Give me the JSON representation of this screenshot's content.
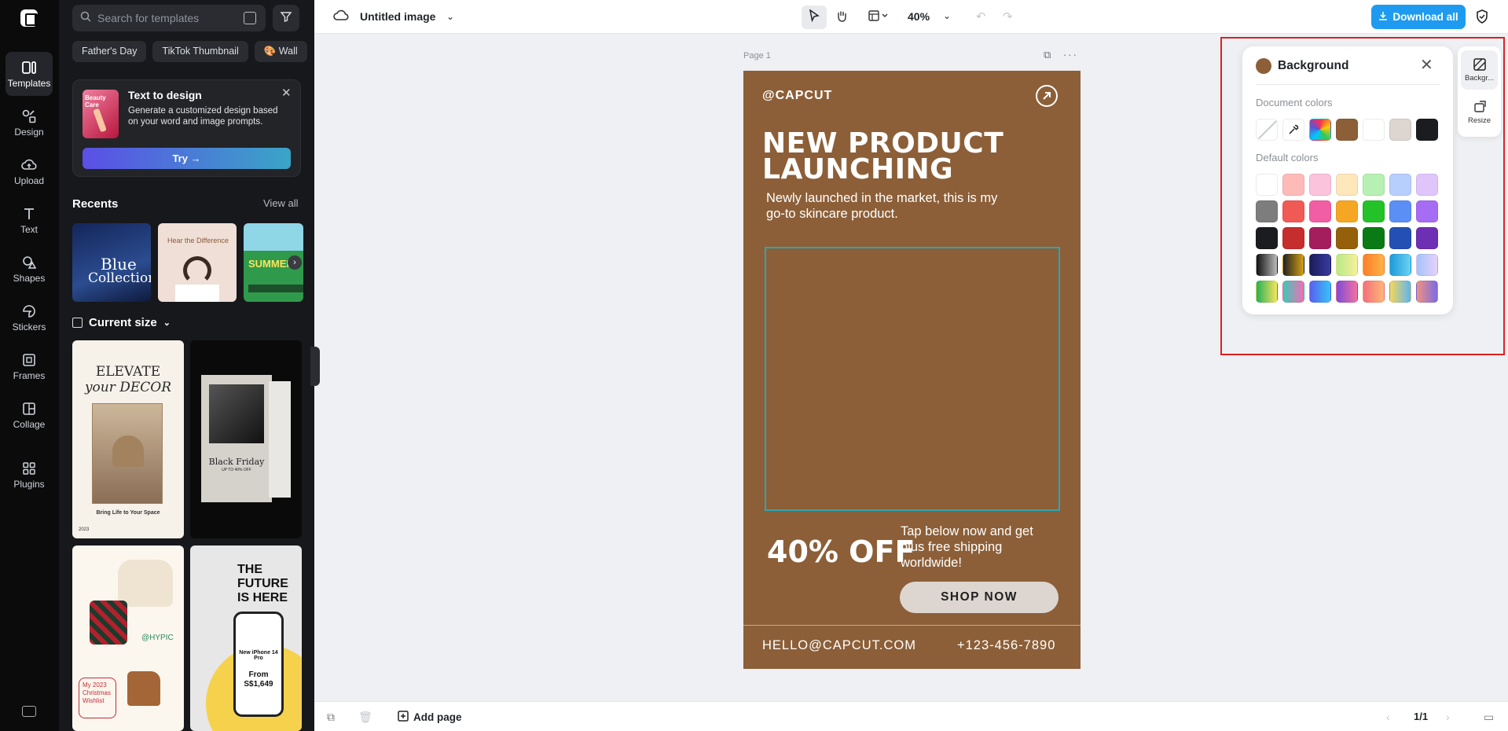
{
  "rail": {
    "items": [
      {
        "label": "Templates",
        "icon": "templates-icon"
      },
      {
        "label": "Design",
        "icon": "design-icon"
      },
      {
        "label": "Upload",
        "icon": "upload-icon"
      },
      {
        "label": "Text",
        "icon": "text-icon"
      },
      {
        "label": "Shapes",
        "icon": "shapes-icon"
      },
      {
        "label": "Stickers",
        "icon": "stickers-icon"
      },
      {
        "label": "Frames",
        "icon": "frames-icon"
      },
      {
        "label": "Collage",
        "icon": "collage-icon"
      },
      {
        "label": "Plugins",
        "icon": "plugins-icon"
      }
    ]
  },
  "panel": {
    "search_placeholder": "Search for templates",
    "chips": [
      "Father's Day",
      "TikTok Thumbnail",
      "Wall"
    ],
    "text_to_design": {
      "thumb_label": "Beauty Care",
      "title": "Text to design",
      "description": "Generate a customized design based on your word and image prompts.",
      "try_label": "Try →"
    },
    "recents": {
      "title": "Recents",
      "view_all": "View all",
      "items": [
        {
          "line1": "Blue",
          "line2": "Collection"
        },
        {
          "line1": "Hear the Difference"
        },
        {
          "line1": "SUMMER"
        }
      ]
    },
    "current_size": "Current size",
    "templates": {
      "t1": {
        "line1": "ELEVATE",
        "line2": "your DECOR",
        "tagline": "Bring Life to Your Space",
        "year": "2023"
      },
      "t2": {
        "line1": "Black Friday",
        "line2": "UP TO 40% OFF"
      },
      "t3": {
        "handle": "@HYPIC",
        "wishlist": "My 2023 Christmas Wishlist"
      },
      "t4": {
        "headline": "THE FUTURE IS HERE",
        "product": "New iPhone 14 Pro",
        "price": "From S$1,649"
      }
    }
  },
  "topbar": {
    "doc_title": "Untitled image",
    "zoom": "40%",
    "download_label": "Download all"
  },
  "canvas": {
    "page_label": "Page 1",
    "design": {
      "brand": "@CAPCUT",
      "headline": "NEW PRODUCT LAUNCHING",
      "subtext": "Newly launched in the market, this is my go-to skincare product.",
      "offer": "40% OFF",
      "cta_text": "Tap below now and get plus free shipping worldwide!",
      "shop_button": "SHOP NOW",
      "email": "HELLO@CAPCUT.COM",
      "phone": "+123-456-7890",
      "background_color": "#8c5f38"
    }
  },
  "background_panel": {
    "title": "Background",
    "document_colors_label": "Document colors",
    "default_colors_label": "Default colors",
    "document_colors": [
      "none",
      "eyedropper",
      "rainbow",
      "#8c5f38",
      "#ffffff",
      "#ddd6d0",
      "#1b1c20"
    ],
    "default_colors": [
      [
        "#ffffff",
        "#fdbab9",
        "#fbc3dc",
        "#fde7bb",
        "#b6f0b2",
        "#b6cffd",
        "#e0c5fb"
      ],
      [
        "#7d7d7d",
        "#f05a55",
        "#f15ea3",
        "#f5a623",
        "#24c229",
        "#5b8ff5",
        "#a66cf3"
      ],
      [
        "#1b1c20",
        "#c62d2d",
        "#a41e5d",
        "#94600a",
        "#0a7a14",
        "#2350b2",
        "#6d2fb3"
      ],
      [
        "linear-gradient(90deg,#111,#bbb)",
        "linear-gradient(90deg,#222,#d4a017)",
        "linear-gradient(90deg,#1b1c5a,#3a3aa0)",
        "linear-gradient(90deg,#b8e986,#f7f09b)",
        "linear-gradient(90deg,#ff7e29,#ffb347)",
        "linear-gradient(90deg,#1e9bd7,#6ad2f7)",
        "linear-gradient(90deg,#a3c4f9,#e7d1fb)"
      ],
      [
        "linear-gradient(90deg,#25b15a,#f9e45b)",
        "linear-gradient(90deg,#3ec9b6,#f26eb6)",
        "linear-gradient(90deg,#5b5fef,#33c5f7)",
        "linear-gradient(90deg,#7c4cd9,#f56fa0)",
        "linear-gradient(90deg,#f56f7c,#fdb776)",
        "linear-gradient(90deg,#f7d65a,#5bb6f2)",
        "linear-gradient(90deg,#f1917e,#7b6be6)"
      ]
    ]
  },
  "side_tabs": [
    {
      "label": "Backgr...",
      "icon": "background-icon"
    },
    {
      "label": "Resize",
      "icon": "resize-icon"
    }
  ],
  "bottombar": {
    "add_page": "Add page",
    "pager": "1/1"
  }
}
